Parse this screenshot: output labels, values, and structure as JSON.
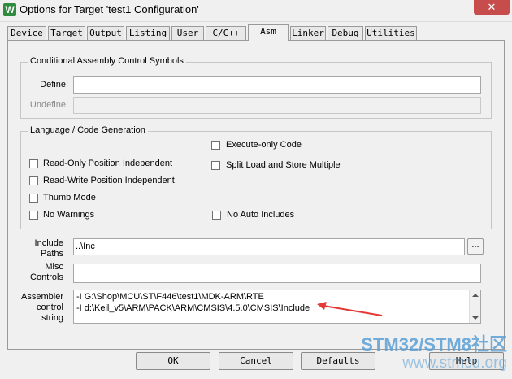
{
  "window": {
    "title": "Options for Target 'test1 Configuration'",
    "close_icon": "close-icon",
    "close_glyph": "✕",
    "app_icon_glyph": "W"
  },
  "tabs": [
    {
      "label": "Device"
    },
    {
      "label": "Target"
    },
    {
      "label": "Output"
    },
    {
      "label": "Listing"
    },
    {
      "label": "User"
    },
    {
      "label": "C/C++"
    },
    {
      "label": "Asm",
      "active": true
    },
    {
      "label": "Linker"
    },
    {
      "label": "Debug"
    },
    {
      "label": "Utilities"
    }
  ],
  "conditional": {
    "title": "Conditional Assembly Control Symbols",
    "define_label": "Define:",
    "define_value": "",
    "undefine_label": "Undefine:",
    "undefine_value": ""
  },
  "language": {
    "title": "Language / Code Generation",
    "options": {
      "execute_only": {
        "label": "Execute-only Code",
        "checked": false
      },
      "ropi": {
        "label": "Read-Only Position Independent",
        "checked": false
      },
      "split_load": {
        "label": "Split Load and Store Multiple",
        "checked": false
      },
      "rwpi": {
        "label": "Read-Write Position Independent",
        "checked": false
      },
      "thumb": {
        "label": "Thumb Mode",
        "checked": false
      },
      "no_warnings": {
        "label": "No Warnings",
        "checked": false
      },
      "no_auto_includes": {
        "label": "No Auto Includes",
        "checked": false
      }
    }
  },
  "include_paths": {
    "label_line1": "Include",
    "label_line2": "Paths",
    "value": "..\\Inc",
    "browse_label": "..."
  },
  "misc_controls": {
    "label_line1": "Misc",
    "label_line2": "Controls",
    "value": ""
  },
  "assembler_control": {
    "label_line1": "Assembler",
    "label_line2": "control",
    "label_line3": "string",
    "lines": [
      "-I G:\\Shop\\MCU\\ST\\F446\\test1\\MDK-ARM\\RTE",
      "-I d:\\Keil_v5\\ARM\\PACK\\ARM\\CMSIS\\4.5.0\\CMSIS\\Include"
    ]
  },
  "annotation": {
    "arrow_color": "#e53935",
    "icon": "red-arrow-icon"
  },
  "buttons": {
    "ok": "OK",
    "cancel": "Cancel",
    "defaults": "Defaults",
    "help": "Help"
  },
  "watermark": {
    "line1": "STM32/STM8社区",
    "line2": "www.stmcu.org"
  }
}
